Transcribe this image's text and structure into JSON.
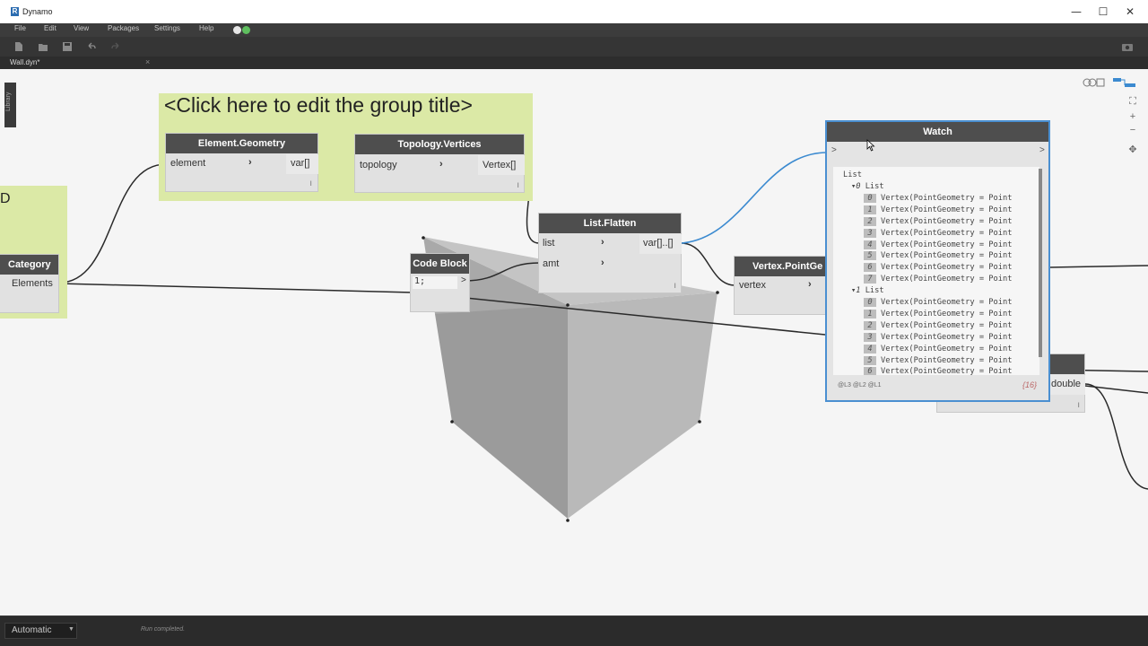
{
  "window": {
    "title": "Dynamo",
    "app_icon_letter": "R",
    "minimize": "—",
    "maximize": "☐",
    "close": "✕"
  },
  "menu": {
    "items": [
      "File",
      "Edit",
      "View",
      "Packages",
      "Settings",
      "Help"
    ]
  },
  "tab": {
    "label": "Wall.dyn*",
    "close": "×"
  },
  "library": {
    "label": "Library"
  },
  "canvas": {
    "group_title": "<Click here to edit the group title>",
    "left_group_fragment": "D",
    "nodes": {
      "category": {
        "title": "Category",
        "output": "Elements"
      },
      "element_geometry": {
        "title": "Element.Geometry",
        "input": "element",
        "output": "var[]",
        "footer": "l"
      },
      "topology_vertices": {
        "title": "Topology.Vertices",
        "input": "topology",
        "output": "Vertex[]",
        "footer": "l"
      },
      "list_flatten": {
        "title": "List.Flatten",
        "input1": "list",
        "input2": "amt",
        "output": "var[]..[]",
        "footer": "l"
      },
      "code_block": {
        "title": "Code Block",
        "code": "1;",
        "output": ">"
      },
      "vertex_point_geometry": {
        "title": "Vertex.PointGe",
        "input": "vertex"
      },
      "hidden_node": {
        "output": "double",
        "footer": "l"
      }
    },
    "watch": {
      "title": "Watch",
      "input_arrow": ">",
      "output_arrow": ">",
      "root": "List",
      "sublist_label": "List",
      "sublists": [
        {
          "index": "0",
          "items": [
            {
              "i": "0",
              "text": "Vertex(PointGeometry = Point"
            },
            {
              "i": "1",
              "text": "Vertex(PointGeometry = Point"
            },
            {
              "i": "2",
              "text": "Vertex(PointGeometry = Point"
            },
            {
              "i": "3",
              "text": "Vertex(PointGeometry = Point"
            },
            {
              "i": "4",
              "text": "Vertex(PointGeometry = Point"
            },
            {
              "i": "5",
              "text": "Vertex(PointGeometry = Point"
            },
            {
              "i": "6",
              "text": "Vertex(PointGeometry = Point"
            },
            {
              "i": "7",
              "text": "Vertex(PointGeometry = Point"
            }
          ]
        },
        {
          "index": "1",
          "items": [
            {
              "i": "0",
              "text": "Vertex(PointGeometry = Point"
            },
            {
              "i": "1",
              "text": "Vertex(PointGeometry = Point"
            },
            {
              "i": "2",
              "text": "Vertex(PointGeometry = Point"
            },
            {
              "i": "3",
              "text": "Vertex(PointGeometry = Point"
            },
            {
              "i": "4",
              "text": "Vertex(PointGeometry = Point"
            },
            {
              "i": "5",
              "text": "Vertex(PointGeometry = Point"
            },
            {
              "i": "6",
              "text": "Vertex(PointGeometry = Point"
            }
          ]
        }
      ],
      "levels": "@L3 @L2 @L1",
      "count": "{16}"
    }
  },
  "bottom": {
    "run_mode": "Automatic",
    "status": "Run completed."
  },
  "colors": {
    "group_fill": "#dbe9a6",
    "node_header": "#4e4e4e",
    "selection_blue": "#4a8fd1",
    "wire_blue": "#3b8ad0"
  }
}
